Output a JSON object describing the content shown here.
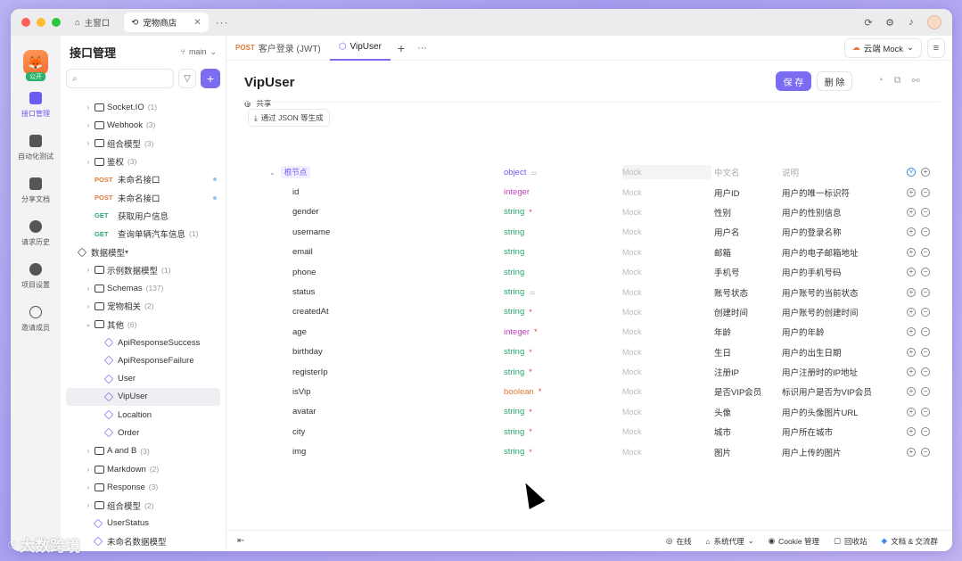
{
  "window": {
    "tabs": [
      {
        "label": "主窗口",
        "icon": "home-icon"
      },
      {
        "label": "宠物商店",
        "icon": "link-icon"
      }
    ]
  },
  "rail": {
    "badge": "公开",
    "items": [
      {
        "label": "接口管理",
        "icon": "api-icon"
      },
      {
        "label": "自动化测试",
        "icon": "stack-icon"
      },
      {
        "label": "分享文档",
        "icon": "book-icon"
      },
      {
        "label": "请求历史",
        "icon": "clock-icon"
      },
      {
        "label": "项目设置",
        "icon": "gear-icon"
      },
      {
        "label": "邀请成员",
        "icon": "user-plus-icon"
      }
    ]
  },
  "sidebar": {
    "title": "接口管理",
    "branch": "main",
    "nodes": [
      {
        "kind": "folder",
        "label": "Socket.IO",
        "count": "(1)"
      },
      {
        "kind": "folder",
        "label": "Webhook",
        "count": "(3)"
      },
      {
        "kind": "folder",
        "label": "组合模型",
        "count": "(3)"
      },
      {
        "kind": "folder",
        "label": "鉴权",
        "count": "(3)"
      },
      {
        "kind": "api",
        "method": "POST",
        "label": "未命名接口"
      },
      {
        "kind": "api",
        "method": "POST",
        "label": "未命名接口"
      },
      {
        "kind": "api",
        "method": "GET",
        "label": "获取用户信息"
      },
      {
        "kind": "api",
        "method": "GET",
        "label": "查询单辆汽车信息",
        "count": "(1)"
      },
      {
        "kind": "section",
        "label": "数据模型"
      },
      {
        "kind": "folder",
        "label": "示例数据模型",
        "count": "(1)"
      },
      {
        "kind": "folder",
        "label": "Schemas",
        "count": "(137)"
      },
      {
        "kind": "folder",
        "label": "宠物相关",
        "count": "(2)"
      },
      {
        "kind": "folder-open",
        "label": "其他",
        "count": "(6)"
      },
      {
        "kind": "model",
        "label": "ApiResponseSuccess"
      },
      {
        "kind": "model",
        "label": "ApiResponseFailure"
      },
      {
        "kind": "model",
        "label": "User"
      },
      {
        "kind": "model",
        "label": "VipUser",
        "selected": true
      },
      {
        "kind": "model",
        "label": "Localtion"
      },
      {
        "kind": "model",
        "label": "Order"
      },
      {
        "kind": "folder",
        "label": "A and B",
        "count": "(3)"
      },
      {
        "kind": "folder",
        "label": "Markdown",
        "count": "(2)"
      },
      {
        "kind": "folder",
        "label": "Response",
        "count": "(3)"
      },
      {
        "kind": "folder",
        "label": "组合模型",
        "count": "(2)"
      },
      {
        "kind": "model-root",
        "label": "UserStatus"
      },
      {
        "kind": "model-root",
        "label": "未命名数据模型"
      }
    ]
  },
  "main": {
    "tabs": [
      {
        "method": "POST",
        "label": "客户登录 (JWT)"
      },
      {
        "label": "VipUser",
        "active": true
      }
    ],
    "env": {
      "label": "云端 Mock"
    },
    "title": "VipUser",
    "shared": "共享",
    "save": "保 存",
    "delete": "删 除",
    "json_button": "通过 JSON 等生成",
    "schema_header": {
      "root": "根节点",
      "type": "object",
      "mock": "Mock",
      "cn": "中文名",
      "desc": "说明"
    },
    "fields": [
      {
        "name": "id",
        "type": "integer",
        "required": false,
        "mock": "Mock",
        "cn": "用户ID",
        "desc": "用户的唯一标识符"
      },
      {
        "name": "gender",
        "type": "string",
        "required": true,
        "mock": "Mock",
        "cn": "性别",
        "desc": "用户的性别信息"
      },
      {
        "name": "username",
        "type": "string",
        "required": false,
        "mock": "Mock",
        "cn": "用户名",
        "desc": "用户的登录名称"
      },
      {
        "name": "email",
        "type": "string",
        "required": false,
        "mock": "Mock",
        "cn": "邮箱",
        "desc": "用户的电子邮箱地址"
      },
      {
        "name": "phone",
        "type": "string",
        "required": false,
        "mock": "Mock",
        "cn": "手机号",
        "desc": "用户的手机号码"
      },
      {
        "name": "status",
        "type": "string",
        "required": false,
        "enum": true,
        "mock": "Mock",
        "cn": "账号状态",
        "desc": "用户账号的当前状态"
      },
      {
        "name": "createdAt",
        "type": "string",
        "required": true,
        "mock": "Mock",
        "cn": "创建时间",
        "desc": "用户账号的创建时间"
      },
      {
        "name": "age",
        "type": "integer",
        "required": true,
        "mock": "Mock",
        "cn": "年龄",
        "desc": "用户的年龄"
      },
      {
        "name": "birthday",
        "type": "string",
        "required": true,
        "mock": "Mock",
        "cn": "生日",
        "desc": "用户的出生日期"
      },
      {
        "name": "registerIp",
        "type": "string",
        "required": true,
        "mock": "Mock",
        "cn": "注册IP",
        "desc": "用户注册时的IP地址"
      },
      {
        "name": "isVip",
        "type": "boolean",
        "required": true,
        "mock": "Mock",
        "cn": "是否VIP会员",
        "desc": "标识用户是否为VIP会员"
      },
      {
        "name": "avatar",
        "type": "string",
        "required": true,
        "mock": "Mock",
        "cn": "头像",
        "desc": "用户的头像图片URL"
      },
      {
        "name": "city",
        "type": "string",
        "required": true,
        "mock": "Mock",
        "cn": "城市",
        "desc": "用户所在城市"
      },
      {
        "name": "img",
        "type": "string",
        "required": true,
        "mock": "Mock",
        "cn": "图片",
        "desc": "用户上传的图片"
      }
    ]
  },
  "statusbar": {
    "items": [
      "在线",
      "系统代理",
      "Cookie 管理",
      "回收站",
      "文档 & 交流群"
    ]
  },
  "watermark": "大数跨境"
}
